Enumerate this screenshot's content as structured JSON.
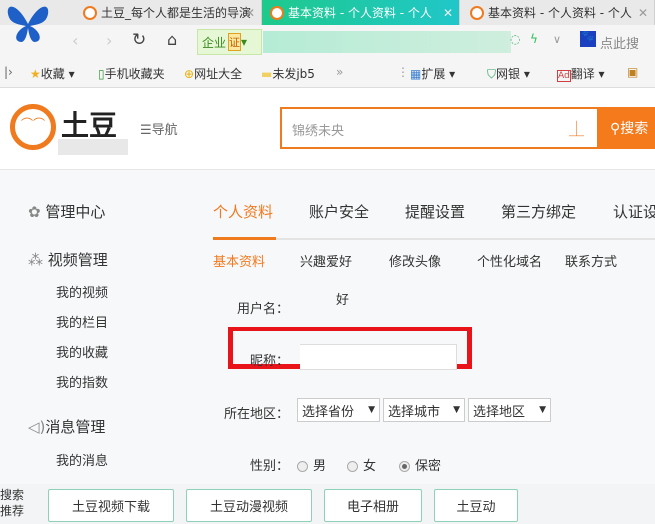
{
  "browser": {
    "tabs": [
      {
        "label": "土豆_每个人都是生活的导演",
        "active": false
      },
      {
        "label": "基本资料 - 个人资料 - 个人",
        "active": true
      },
      {
        "label": "基本资料 - 个人资料 - 个人",
        "active": false
      }
    ],
    "badge": "企业",
    "badge_cert": "证",
    "search_hint": "点此搜",
    "bookmarks": [
      "收藏",
      "手机收藏夹",
      "网址大全",
      "未发jb5",
      "»",
      "扩展",
      "网银",
      "翻译"
    ]
  },
  "header": {
    "logo": "土豆",
    "nav": "导航",
    "search_placeholder": "锦绣未央",
    "search_button": "搜索"
  },
  "sidebar": {
    "sections": [
      {
        "title": "管理中心"
      },
      {
        "title": "视频管理",
        "items": [
          "我的视频",
          "我的栏目",
          "我的收藏",
          "我的指数"
        ]
      },
      {
        "title": "消息管理",
        "items": [
          "我的消息"
        ]
      }
    ]
  },
  "main": {
    "tabs": [
      "个人资料",
      "账户安全",
      "提醒设置",
      "第三方绑定",
      "认证设置"
    ],
    "subtabs": [
      "基本资料",
      "兴趣爱好",
      "修改头像",
      "个性化域名",
      "联系方式"
    ],
    "form": {
      "username_label": "用户名：",
      "username_value": "好",
      "nickname_label": "昵称：",
      "region_label": "所在地区：",
      "province": "选择省份",
      "city": "选择城市",
      "district": "选择地区",
      "gender_label": "性别：",
      "genders": [
        "男",
        "女",
        "保密"
      ],
      "gender_selected": "保密"
    }
  },
  "footer": {
    "label": "搜索推荐",
    "buttons": [
      "土豆视频下载",
      "土豆动漫视频",
      "电子相册",
      "土豆动"
    ]
  },
  "colors": {
    "accent": "#f07a1e",
    "highlight": "#e8141a",
    "tab_active": "#1ec98b"
  }
}
